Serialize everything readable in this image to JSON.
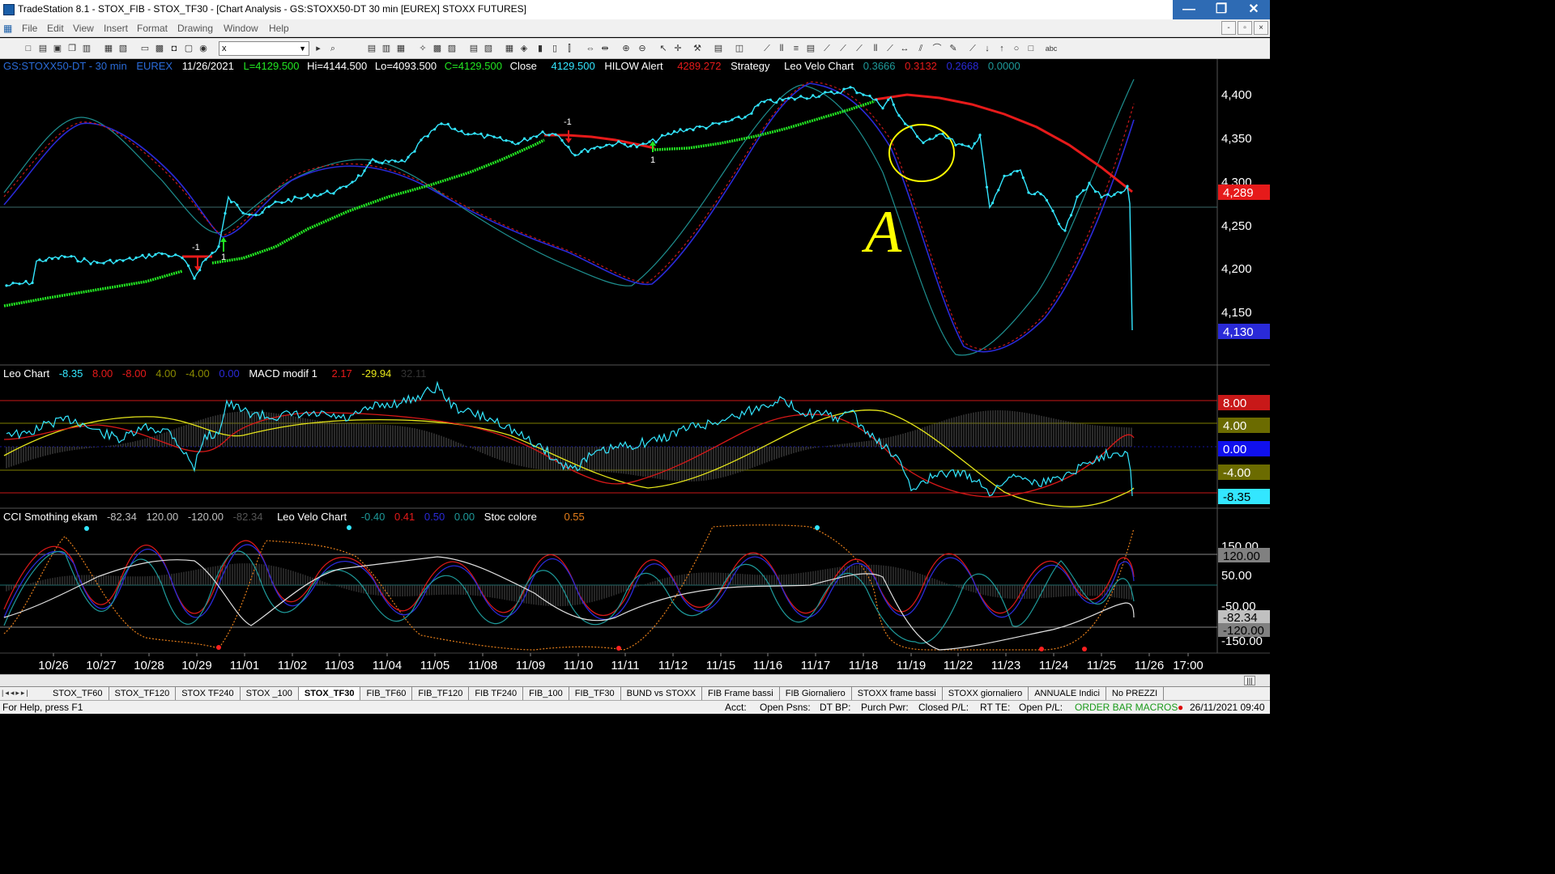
{
  "window": {
    "title": "TradeStation 8.1 - STOX_FIB - STOX_TF30 - [Chart Analysis - GS:STOXX50-DT  30 min  [EUREX] STOXX FUTURES]",
    "controls": [
      "—",
      "❐",
      "✕"
    ]
  },
  "menu": {
    "items": [
      "File",
      "Edit",
      "View",
      "Insert",
      "Format",
      "Drawing",
      "Window",
      "Help"
    ],
    "mdi_controls": [
      "-",
      "▫",
      "×"
    ]
  },
  "toolbar": {
    "symbol_value": "x"
  },
  "price_header": {
    "symbol": "GS:STOXX50-DT - 30 min",
    "exchange": "EUREX",
    "date": "11/26/2021",
    "last": "L=4129.500",
    "high": "Hi=4144.500",
    "low": "Lo=4093.500",
    "close_c": "C=4129.500",
    "close_label": "Close",
    "close_value": "4129.500",
    "hilow": "HILOW Alert",
    "hilow_value": "4289.272",
    "strategy": "Strategy",
    "leo_velo": "Leo Velo Chart",
    "lv1": "0.3666",
    "lv2": "0.3132",
    "lv3": "0.2668",
    "lv4": "0.0000"
  },
  "macd_header": {
    "name": "Leo Chart",
    "v1": "-8.35",
    "v2": "8.00",
    "v3": "-8.00",
    "v4": "4.00",
    "v5": "-4.00",
    "v6": "0.00",
    "macd": "MACD modif 1",
    "m1": "2.17",
    "m2": "-29.94",
    "m3": "32.11"
  },
  "cci_header": {
    "name": "CCI Smothing ekam",
    "c1": "-82.34",
    "c2": "120.00",
    "c3": "-120.00",
    "c4": "-82.34",
    "leo": "Leo Velo Chart",
    "l1": "-0.40",
    "l2": "0.41",
    "l3": "0.50",
    "l4": "0.00",
    "stoc": "Stoc colore",
    "s1": "0.55"
  },
  "price_axis": [
    "4,400",
    "4,350",
    "4,300",
    "4,250",
    "4,200",
    "4,150"
  ],
  "price_tags": {
    "hilow": "4,289",
    "last": "4,130"
  },
  "macd_tags": [
    "8.00",
    "4.00",
    "0.00",
    "-4.00",
    "-8.35"
  ],
  "cci_axis": [
    "150.00",
    "120.00",
    "50.00",
    "-50.00",
    "-82.34",
    "-120.00",
    "-150.00"
  ],
  "date_axis": [
    "10/26",
    "10/27",
    "10/28",
    "10/29",
    "11/01",
    "11/02",
    "11/03",
    "11/04",
    "11/05",
    "11/08",
    "11/09",
    "11/10",
    "11/11",
    "11/12",
    "11/15",
    "11/16",
    "11/17",
    "11/18",
    "11/19",
    "11/22",
    "11/23",
    "11/24",
    "11/25",
    "11/26",
    "17:00"
  ],
  "signals": [
    "-1",
    "1",
    "-1",
    "1"
  ],
  "annotation_letter": "A",
  "tabs": [
    "STOX_TF60",
    "STOX_TF120",
    "STOX TF240",
    "STOX _100",
    "STOX_TF30",
    "FIB_TF60",
    "FIB_TF120",
    "FIB TF240",
    "FIB_100",
    "FIB_TF30",
    "BUND vs STOXX",
    "FIB Frame bassi",
    "FIB Giornaliero",
    "STOXX frame bassi",
    "STOXX giornaliero",
    "ANNUALE Indici",
    "No PREZZI"
  ],
  "active_tab": "STOX_TF30",
  "status": {
    "help": "For Help, press F1",
    "acct": "Acct:",
    "open_psns": "Open Psns:",
    "dt_bp": "DT BP:",
    "purch_pwr": "Purch Pwr:",
    "closed_pl": "Closed P/L:",
    "rt_te": "RT TE:",
    "open_pl": "Open P/L:",
    "order_bar": "ORDER BAR  MACROS",
    "datetime": "26/11/2021 09:40"
  },
  "colors": {
    "price_line": "#33e6ff",
    "hilow_up": "#ff1a1a",
    "hilow_down": "#22e622",
    "ma_blue": "#2a2ad8",
    "ma_red": "#d02020",
    "ma_teal": "#1e9a9a",
    "annotation": "#ffff00"
  }
}
